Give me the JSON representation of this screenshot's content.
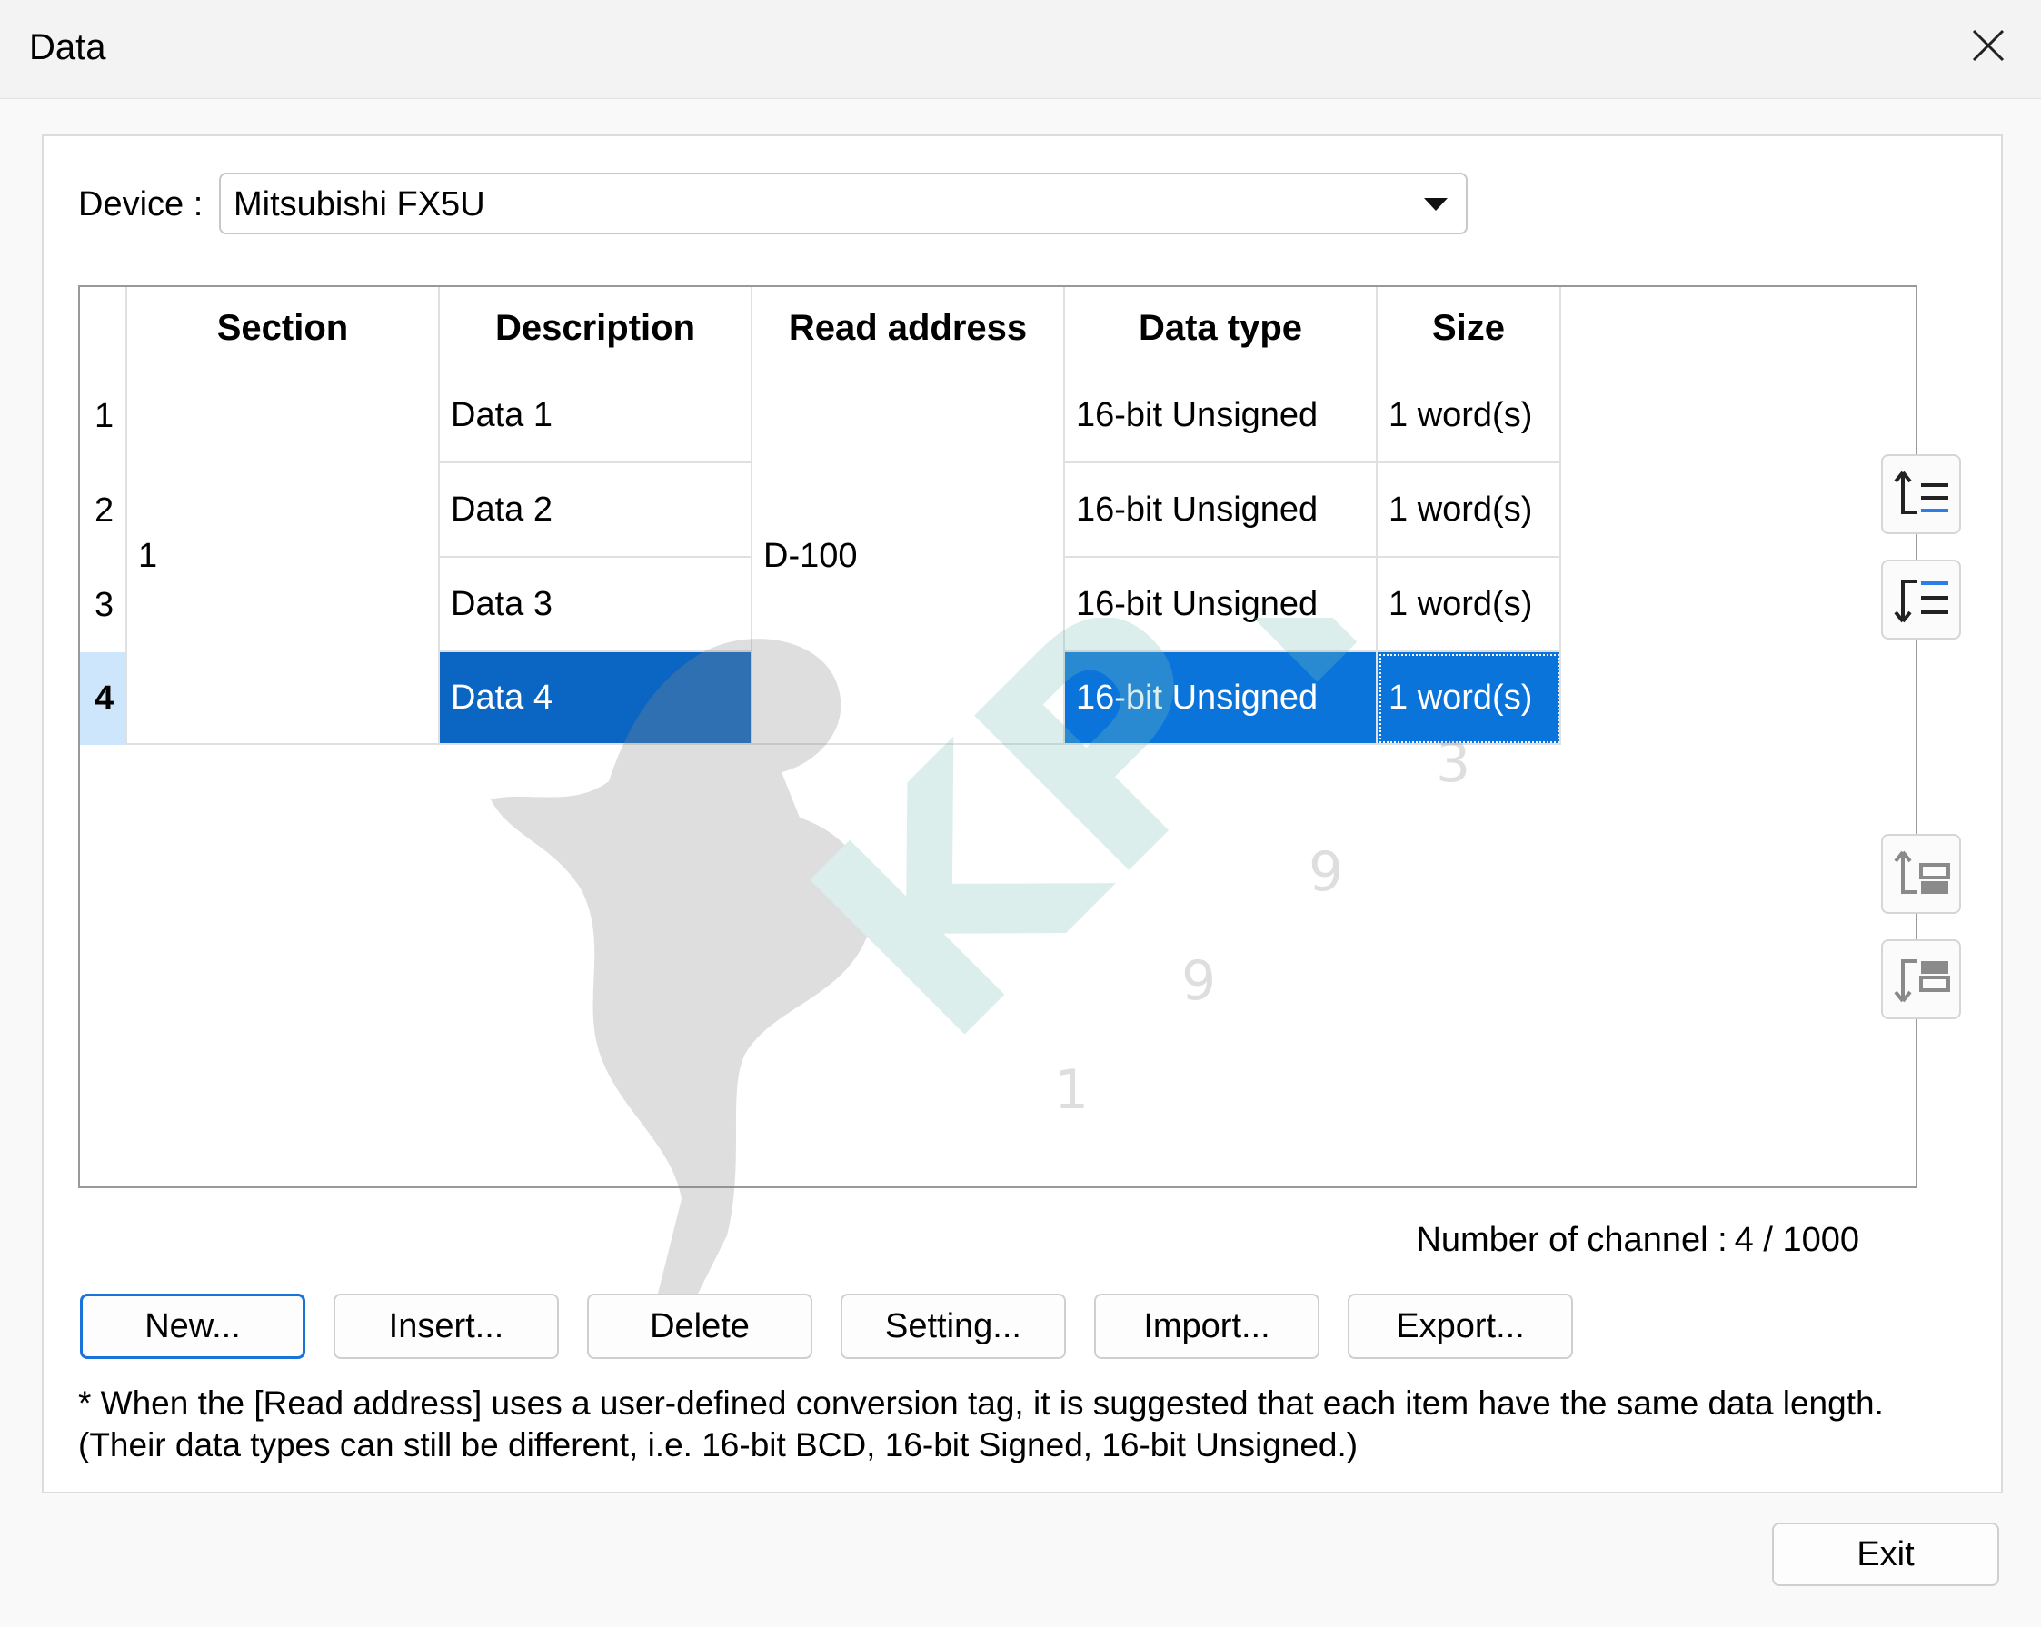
{
  "window": {
    "title": "Data"
  },
  "device": {
    "label": "Device :",
    "value": "Mitsubishi FX5U"
  },
  "table": {
    "headers": [
      "Section",
      "Description",
      "Read address",
      "Data type",
      "Size"
    ],
    "section_value": "1",
    "read_address": "D-100",
    "rows": [
      {
        "num": "1",
        "description": "Data 1",
        "data_type": "16-bit Unsigned",
        "size": "1 word(s)"
      },
      {
        "num": "2",
        "description": "Data 2",
        "data_type": "16-bit Unsigned",
        "size": "1 word(s)"
      },
      {
        "num": "3",
        "description": "Data 3",
        "data_type": "16-bit Unsigned",
        "size": "1 word(s)"
      },
      {
        "num": "4",
        "description": "Data 4",
        "data_type": "16-bit Unsigned",
        "size": "1 word(s)"
      }
    ],
    "selected_row": 4
  },
  "side_buttons": [
    "move-row-up-icon",
    "move-row-down-icon",
    "move-section-up-icon",
    "move-section-down-icon"
  ],
  "channel": {
    "label": "Number of channel :",
    "value": "4 / 1000"
  },
  "buttons": {
    "new": "New...",
    "insert": "Insert...",
    "delete": "Delete",
    "setting": "Setting...",
    "import": "Import...",
    "export": "Export..."
  },
  "note": "* When the [Read address] uses a user-defined conversion tag, it is suggested that each item have the same data length. (Their data types can still be different, i.e. 16-bit BCD, 16-bit Signed, 16-bit Unsigned.)",
  "exit": "Exit",
  "watermark": {
    "letters": "KPT",
    "digits": [
      "1",
      "9",
      "9",
      "3"
    ]
  },
  "colors": {
    "selection": "#0a74da",
    "primary_border": "#1a73d9"
  }
}
